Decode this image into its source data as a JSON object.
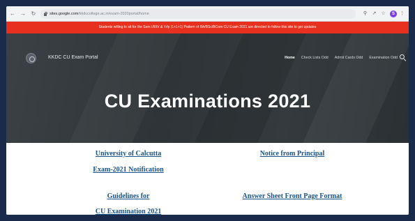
{
  "browser": {
    "url_host": "sites.google.com",
    "url_path": "/kkdccollege.ac.in/exam-2020portal/home",
    "profile_initial": "S"
  },
  "banner": {
    "text": "Students willing to sit for the Sem I/III/V & Yrly (1+1+1) Pattern of BA/BSc/BCom CU Exam 2021 are directed to follow this site to get updates"
  },
  "header": {
    "site_title": "KKDC CU Exam Portal",
    "nav": [
      {
        "label": "Home"
      },
      {
        "label": "Check Lists Odd"
      },
      {
        "label": "Admit Cards Odd"
      },
      {
        "label": "Examination Odd"
      }
    ]
  },
  "hero": {
    "title": "CU Examinations 2021"
  },
  "links": {
    "university": "University of Calcutta",
    "exam_notification": "Exam-2021 Notification",
    "notice_principal": "Notice from Principal",
    "guidelines": "Guidelines for",
    "cu_examination": "CU Examination 2021",
    "answer_sheet": "Answer Sheet Front Page Format"
  },
  "colors": {
    "banner_bg": "#e8301e",
    "hero_bg": "#343a3d",
    "link": "#1a5489",
    "page_frame": "#1a2a4a"
  }
}
